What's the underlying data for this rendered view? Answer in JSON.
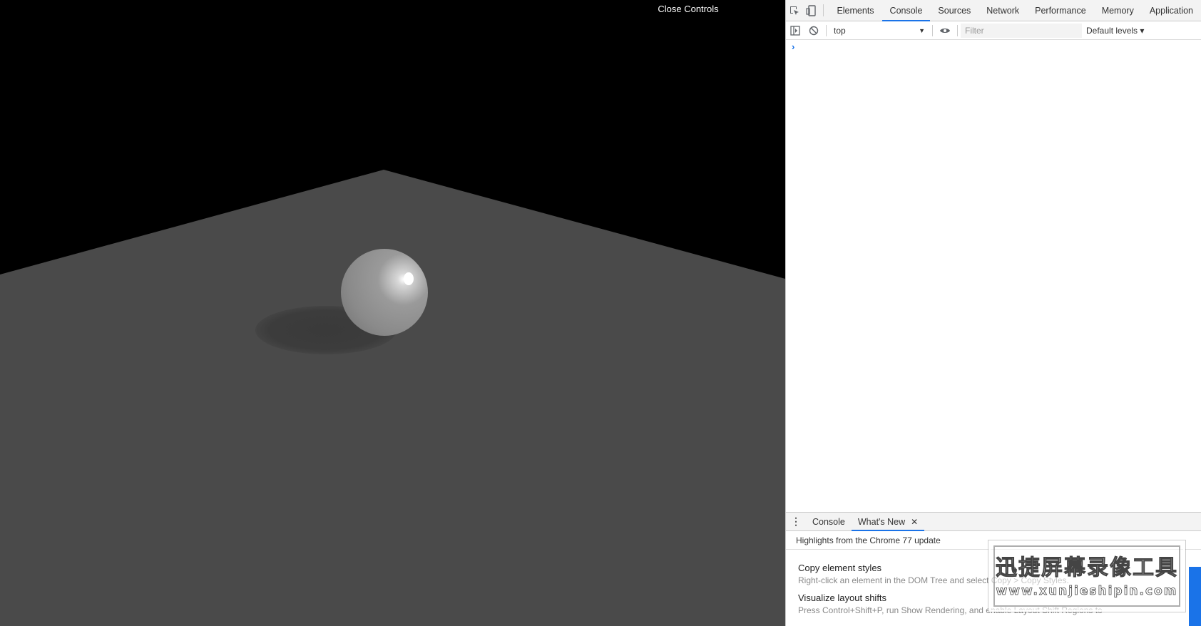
{
  "viewport": {
    "close_controls": "Close Controls"
  },
  "devtools": {
    "tabs": [
      {
        "label": "Elements",
        "active": false
      },
      {
        "label": "Console",
        "active": true
      },
      {
        "label": "Sources",
        "active": false
      },
      {
        "label": "Network",
        "active": false
      },
      {
        "label": "Performance",
        "active": false
      },
      {
        "label": "Memory",
        "active": false
      },
      {
        "label": "Application",
        "active": false
      }
    ],
    "toolbar": {
      "context": "top",
      "filter_placeholder": "Filter",
      "levels": "Default levels ▾"
    },
    "console": {
      "prompt": "›"
    },
    "drawer": {
      "tabs": [
        {
          "label": "Console",
          "active": false
        },
        {
          "label": "What's New",
          "active": true,
          "closable": true
        }
      ],
      "close_glyph": "✕",
      "highlights": "Highlights from the Chrome 77 update",
      "items": [
        {
          "title": "Copy element styles",
          "desc": "Right-click an element in the DOM Tree and select Copy > Copy Styles."
        },
        {
          "title": "Visualize layout shifts",
          "desc": "Press Control+Shift+P, run Show Rendering, and enable Layout Shift Regions to"
        }
      ]
    }
  },
  "watermark": {
    "title": "迅捷屏幕录像工具",
    "url": "www.xunjieshipin.com"
  },
  "colors": {
    "accent": "#1a73e8",
    "floor": "#4a4a4a",
    "background": "#000000"
  }
}
